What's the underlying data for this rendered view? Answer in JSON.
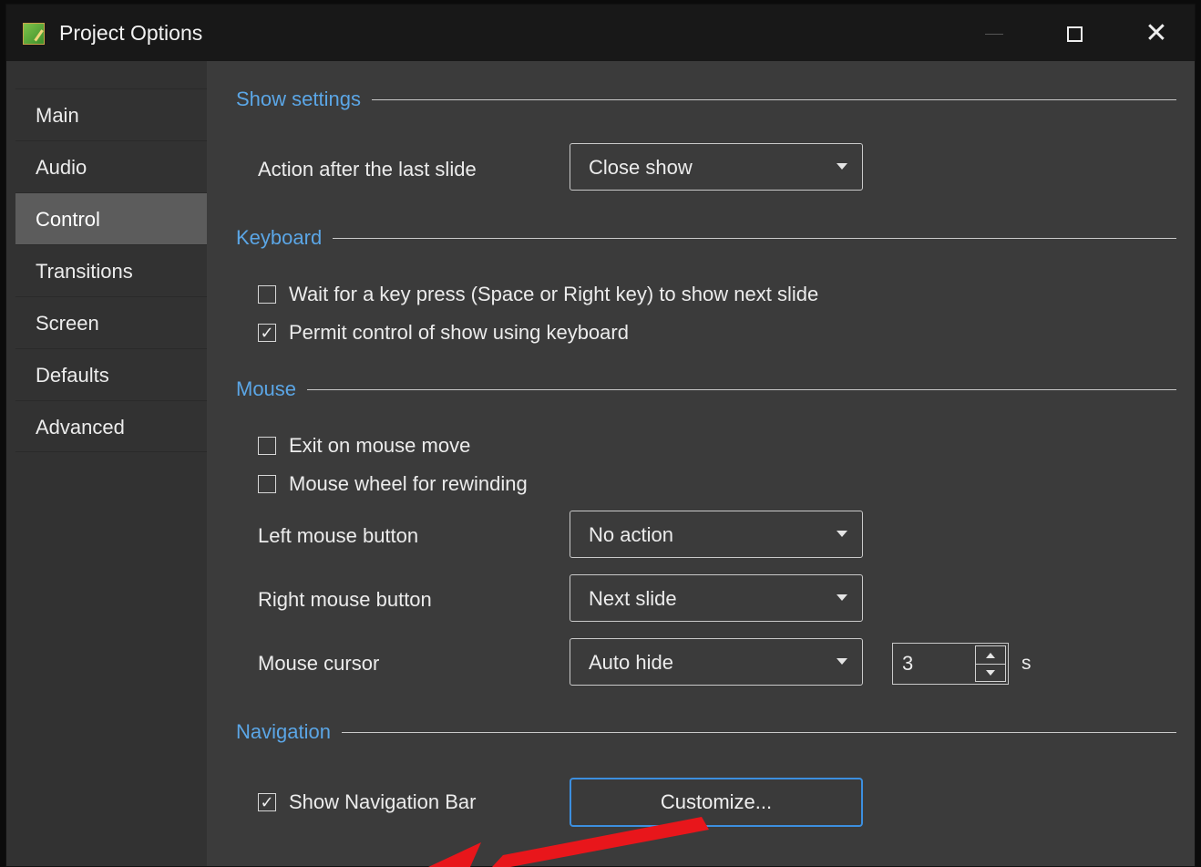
{
  "window": {
    "title": "Project Options"
  },
  "sidebar": {
    "items": [
      {
        "label": "Main"
      },
      {
        "label": "Audio"
      },
      {
        "label": "Control"
      },
      {
        "label": "Transitions"
      },
      {
        "label": "Screen"
      },
      {
        "label": "Defaults"
      },
      {
        "label": "Advanced"
      }
    ],
    "active": "Control"
  },
  "show_settings": {
    "header": "Show settings",
    "action_label": "Action after the last slide",
    "action_value": "Close show"
  },
  "keyboard": {
    "header": "Keyboard",
    "wait_key": {
      "label": "Wait for a key press (Space or Right key) to show next slide",
      "checked": false
    },
    "permit_control": {
      "label": "Permit control of show using keyboard",
      "checked": true
    }
  },
  "mouse": {
    "header": "Mouse",
    "exit_on_move": {
      "label": "Exit on mouse move",
      "checked": false
    },
    "wheel_rewind": {
      "label": "Mouse wheel for rewinding",
      "checked": false
    },
    "left_label": "Left mouse button",
    "left_value": "No action",
    "right_label": "Right mouse button",
    "right_value": "Next slide",
    "cursor_label": "Mouse cursor",
    "cursor_value": "Auto hide",
    "cursor_seconds": "3",
    "seconds_unit": "s"
  },
  "navigation": {
    "header": "Navigation",
    "show_bar": {
      "label": "Show Navigation Bar",
      "checked": true
    },
    "customize_label": "Customize..."
  },
  "colors": {
    "accent": "#5ba6e6",
    "arrow": "#e8161b",
    "active_tab": "#5c5c5c"
  }
}
